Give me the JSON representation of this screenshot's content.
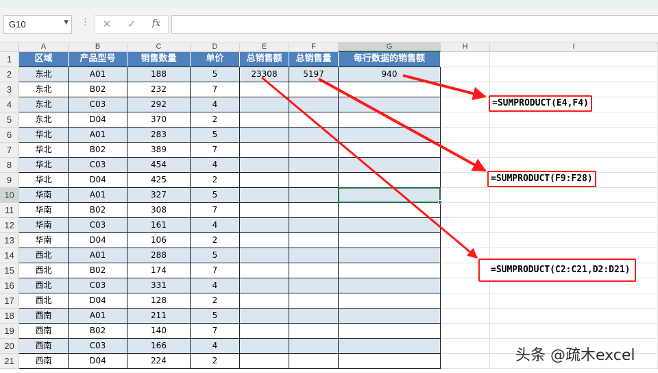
{
  "formula_bar": {
    "name_box": "G10",
    "dots": "⋮",
    "cancel_symbol": "✕",
    "enter_symbol": "✓",
    "fx_symbol": "fx",
    "formula_value": ""
  },
  "columns": [
    "A",
    "B",
    "C",
    "D",
    "E",
    "F",
    "G",
    "H",
    "I"
  ],
  "rows": [
    "1",
    "2",
    "3",
    "4",
    "5",
    "6",
    "7",
    "8",
    "9",
    "10",
    "11",
    "12",
    "13",
    "14",
    "15",
    "16",
    "17",
    "18",
    "19",
    "20",
    "21"
  ],
  "selected_cell": "G10",
  "table": {
    "headers": [
      "区域",
      "产品型号",
      "销售数量",
      "单价",
      "总销售额",
      "总销售量",
      "每行数据的销售额"
    ],
    "data": [
      [
        "东北",
        "A01",
        "188",
        "5"
      ],
      [
        "东北",
        "B02",
        "232",
        "7"
      ],
      [
        "东北",
        "C03",
        "292",
        "4"
      ],
      [
        "东北",
        "D04",
        "370",
        "2"
      ],
      [
        "华北",
        "A01",
        "283",
        "5"
      ],
      [
        "华北",
        "B02",
        "389",
        "7"
      ],
      [
        "华北",
        "C03",
        "454",
        "4"
      ],
      [
        "华北",
        "D04",
        "425",
        "2"
      ],
      [
        "华南",
        "A01",
        "327",
        "5"
      ],
      [
        "华南",
        "B02",
        "308",
        "7"
      ],
      [
        "华南",
        "C03",
        "161",
        "4"
      ],
      [
        "华南",
        "D04",
        "106",
        "2"
      ],
      [
        "西北",
        "A01",
        "288",
        "5"
      ],
      [
        "西北",
        "B02",
        "174",
        "7"
      ],
      [
        "西北",
        "C03",
        "331",
        "4"
      ],
      [
        "西北",
        "D04",
        "128",
        "2"
      ],
      [
        "西南",
        "A01",
        "211",
        "5"
      ],
      [
        "西南",
        "B02",
        "140",
        "7"
      ],
      [
        "西南",
        "C03",
        "166",
        "4"
      ],
      [
        "西南",
        "D04",
        "224",
        "2"
      ]
    ],
    "e2": "23308",
    "f2": "5197",
    "g2": "940"
  },
  "annotations": {
    "formula_1": "=SUMPRODUCT(E4,F4)",
    "formula_2": "=SUMPRODUCT(F9:F28)",
    "formula_3": "=SUMPRODUCT(C2:C21,D2:D21)",
    "arrow_color": "#ff1a1a"
  },
  "watermark": "头条 @疏木excel"
}
